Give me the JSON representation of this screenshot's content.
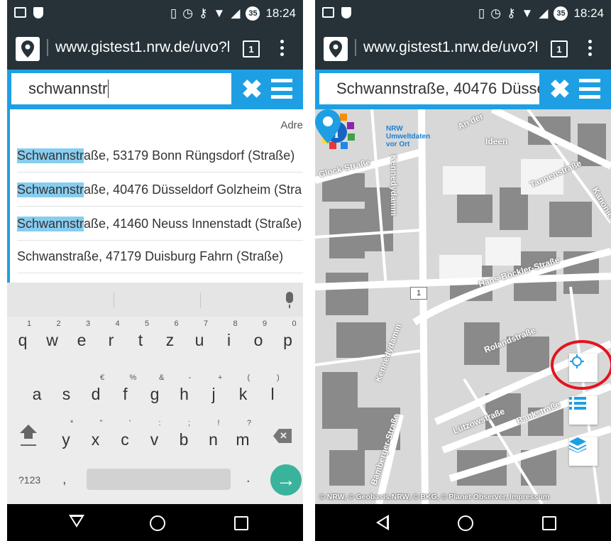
{
  "status_bar": {
    "time": "18:24",
    "battery": "35"
  },
  "browser": {
    "url": "www.gistest1.nrw.de/uvo?l",
    "url_right": "www.gistest1.nrw.de/uvo?l",
    "tab_count": "1"
  },
  "left_screen": {
    "search_value": "schwannstr",
    "suggest_header": "Adre",
    "suggestions": [
      {
        "highlight": "Schwannstr",
        "rest": "aße, 53179 Bonn Rüngsdorf (Straße)"
      },
      {
        "highlight": "Schwannstr",
        "rest": "aße, 40476 Düsseldorf Golzheim (Stra"
      },
      {
        "highlight": "Schwannstr",
        "rest": "aße, 41460 Neuss Innenstadt (Straße)"
      },
      {
        "highlight": "",
        "rest": "Schwanstraße, 47179 Duisburg Fahrn (Straße)"
      }
    ],
    "keyboard": {
      "row1": [
        {
          "key": "q",
          "hint": "1"
        },
        {
          "key": "w",
          "hint": "2"
        },
        {
          "key": "e",
          "hint": "3"
        },
        {
          "key": "r",
          "hint": "4"
        },
        {
          "key": "t",
          "hint": "5"
        },
        {
          "key": "z",
          "hint": "6"
        },
        {
          "key": "u",
          "hint": "7"
        },
        {
          "key": "i",
          "hint": "8"
        },
        {
          "key": "o",
          "hint": "9"
        },
        {
          "key": "p",
          "hint": "0"
        }
      ],
      "row2": [
        {
          "key": "a",
          "hint": ""
        },
        {
          "key": "s",
          "hint": ""
        },
        {
          "key": "d",
          "hint": "€"
        },
        {
          "key": "f",
          "hint": "%"
        },
        {
          "key": "g",
          "hint": "&"
        },
        {
          "key": "h",
          "hint": "-"
        },
        {
          "key": "j",
          "hint": "+"
        },
        {
          "key": "k",
          "hint": "("
        },
        {
          "key": "l",
          "hint": ")"
        }
      ],
      "row3": [
        {
          "key": "y",
          "hint": "*"
        },
        {
          "key": "x",
          "hint": "\""
        },
        {
          "key": "c",
          "hint": "'"
        },
        {
          "key": "v",
          "hint": ":"
        },
        {
          "key": "b",
          "hint": ";"
        },
        {
          "key": "n",
          "hint": "!"
        },
        {
          "key": "m",
          "hint": "?"
        }
      ],
      "num_label": "?123",
      "comma": ",",
      "period": ".",
      "go": "→"
    }
  },
  "right_screen": {
    "search_value": "Schwannstraße, 40476 Düsse",
    "logo_text": "NRW Umweltdaten vor Ort",
    "street_labels": [
      "Hans-Böckler-Straße",
      "Kennedydamm",
      "Kennedydamm",
      "Rolandstraße",
      "Lützowstraße",
      "Bankstraße",
      "Tannenstraße",
      "Kanonierstraße",
      "An der",
      "Glock-Straße",
      "Bamberger-Straße",
      "Ideen"
    ],
    "road_badge": "1",
    "attribution": "© NRW, © Geobasis.NRW, © BKG, © Planet Observer, Impressum"
  },
  "colors": {
    "accent": "#1e9fe3",
    "bar_dark": "#263238",
    "highlight": "#87cdf0",
    "go_key": "#3ab39c",
    "annotation_red": "#e3141e"
  }
}
